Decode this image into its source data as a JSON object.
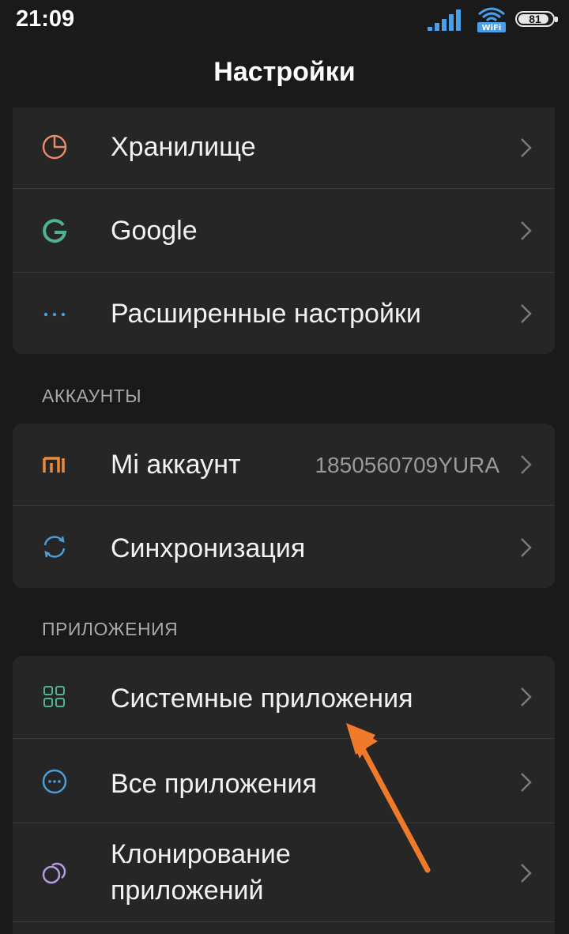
{
  "status_bar": {
    "time": "21:09",
    "wifi_label": "WiFi",
    "battery": "81"
  },
  "header": {
    "title": "Настройки"
  },
  "top_group": {
    "items": [
      {
        "label": "Хранилище",
        "icon": "storage-pie-icon",
        "icon_color": "#e8896a"
      },
      {
        "label": "Google",
        "icon": "google-g-icon",
        "icon_color": "#4fb38f"
      },
      {
        "label": "Расширенные настройки",
        "icon": "more-dots-icon",
        "icon_color": "#4a9fd8"
      }
    ]
  },
  "accounts": {
    "header": "АККАУНТЫ",
    "items": [
      {
        "label": "Mi аккаунт",
        "value": "1850560709YURA",
        "icon": "mi-logo-icon",
        "icon_color": "#ec8a3a"
      },
      {
        "label": "Синхронизация",
        "icon": "sync-icon",
        "icon_color": "#4a9fd8"
      }
    ]
  },
  "apps": {
    "header": "ПРИЛОЖЕНИЯ",
    "items": [
      {
        "label": "Системные приложения",
        "icon": "grid-apps-icon",
        "icon_color": "#4fb38f"
      },
      {
        "label": "Все приложения",
        "icon": "circle-dots-icon",
        "icon_color": "#4a9fd8"
      },
      {
        "label_line1": "Клонирование",
        "label_line2": "приложений",
        "icon": "clone-circles-icon",
        "icon_color": "#b49ae0"
      }
    ]
  },
  "annotation": {
    "arrow_color": "#f07a2a"
  }
}
